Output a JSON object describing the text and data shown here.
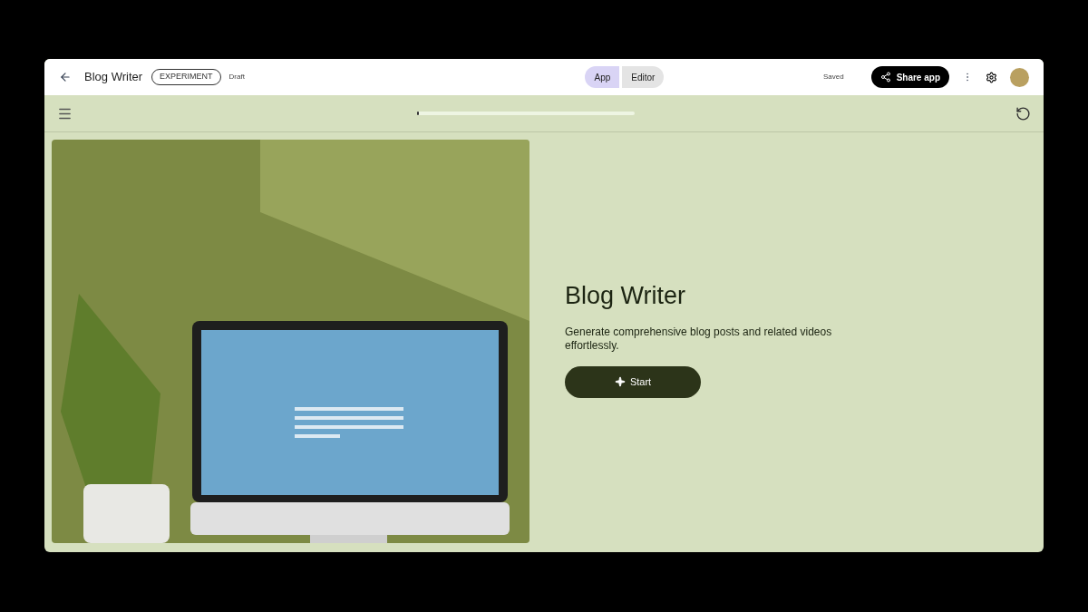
{
  "header": {
    "title": "Blog Writer",
    "badge": "EXPERIMENT",
    "status": "Draft",
    "tabs": [
      {
        "label": "App",
        "selected": true
      },
      {
        "label": "Editor",
        "selected": false
      }
    ],
    "saved": "Saved",
    "share_button": "Share app"
  },
  "toolbar": {
    "progress": {
      "level": 0.01
    }
  },
  "hero": {
    "title": "Blog Writer",
    "description": "Generate comprehensive blog posts and related videos effortlessly.",
    "start_button": "Start"
  }
}
